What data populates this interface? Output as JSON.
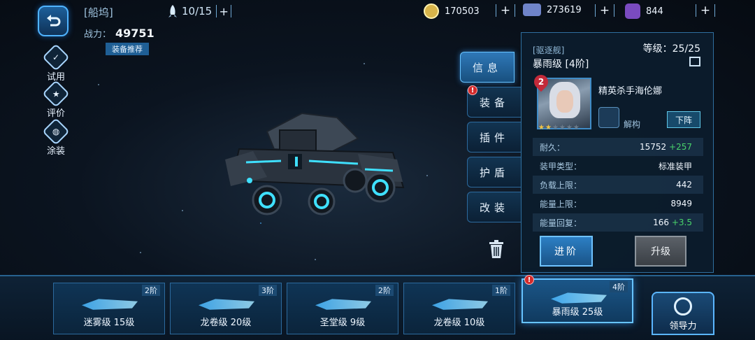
{
  "header": {
    "dock_title": "[船坞]",
    "ship_count": "10/15",
    "power_label": "战力：",
    "power_value": "49751",
    "equip_recommend": "装备推荐"
  },
  "resources": [
    {
      "name": "gold-coin-icon",
      "value": "170503",
      "color": "#d8b44a"
    },
    {
      "name": "crystal-icon",
      "value": "273619",
      "color": "#6f84c9"
    },
    {
      "name": "gem-icon",
      "value": "844",
      "color": "#7a4bc0"
    }
  ],
  "side_buttons": {
    "trial": "试用",
    "review": "评价",
    "paint": "涂装"
  },
  "tabs": {
    "info": "信息",
    "equip": "装备",
    "plugin": "插件",
    "shield": "护盾",
    "modify": "改装"
  },
  "panel": {
    "ship_type": "[驱逐舰]",
    "ship_name": "暴雨级 [4阶]",
    "level": "等级：25/25",
    "captain_level": "2",
    "captain_name": "精英杀手海伦娜",
    "captain_stars": 2,
    "captain_star_max": 6,
    "dismantle": "解构",
    "unassign": "下阵",
    "stats": [
      {
        "key": "耐久：",
        "value": "15752",
        "bonus": "+257"
      },
      {
        "key": "装甲类型：",
        "value": "标准装甲",
        "bonus": ""
      },
      {
        "key": "负载上限：",
        "value": "442",
        "bonus": ""
      },
      {
        "key": "能量上限：",
        "value": "8949",
        "bonus": ""
      },
      {
        "key": "能量回复：",
        "value": "166",
        "bonus": "+3.5"
      }
    ],
    "advance": "进阶",
    "upgrade": "升级"
  },
  "fleet": [
    {
      "name": "迷雾级 15级",
      "tier": "2阶"
    },
    {
      "name": "龙卷级 20级",
      "tier": "3阶"
    },
    {
      "name": "圣堂级 9级",
      "tier": "2阶"
    },
    {
      "name": "龙卷级 10级",
      "tier": "1阶"
    },
    {
      "name": "暴雨级 25级",
      "tier": "4阶"
    }
  ],
  "leadership": "领导力",
  "alert_mark": "!",
  "colors": {
    "accent": "#67c3ff",
    "positive": "#49d36b",
    "alert": "#d42b2b"
  }
}
